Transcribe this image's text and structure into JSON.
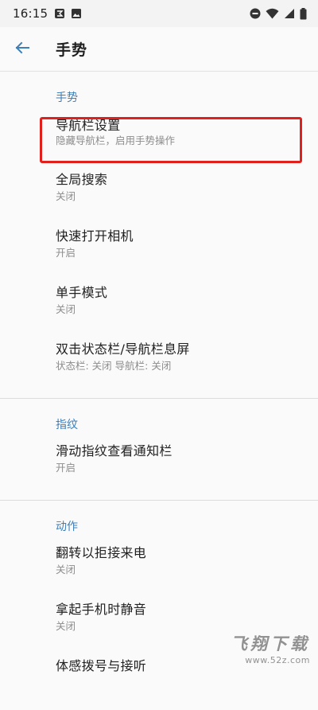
{
  "status_bar": {
    "time": "16:15",
    "left_icons": [
      "app-notification-icon",
      "image-icon"
    ],
    "right_icons": [
      "do-not-disturb-icon",
      "wifi-icon",
      "signal-icon",
      "battery-icon"
    ]
  },
  "app_bar": {
    "back_icon": "arrow-left-icon",
    "title": "手势"
  },
  "sections": [
    {
      "header": "手势",
      "items": [
        {
          "title": "导航栏设置",
          "summary": "隐藏导航栏，启用手势操作",
          "highlighted": true
        },
        {
          "title": "全局搜索",
          "summary": "关闭"
        },
        {
          "title": "快速打开相机",
          "summary": "开启"
        },
        {
          "title": "单手模式",
          "summary": "关闭"
        },
        {
          "title": "双击状态栏/导航栏息屏",
          "summary": "状态栏: 关闭  导航栏: 关闭"
        }
      ]
    },
    {
      "header": "指纹",
      "items": [
        {
          "title": "滑动指纹查看通知栏",
          "summary": "开启"
        }
      ]
    },
    {
      "header": "动作",
      "items": [
        {
          "title": "翻转以拒接来电",
          "summary": "关闭"
        },
        {
          "title": "拿起手机时静音",
          "summary": "关闭"
        },
        {
          "title": "体感拨号与接听",
          "summary": ""
        }
      ]
    }
  ],
  "colors": {
    "accent": "#3f7fb8",
    "highlight_border": "#e0201c",
    "background": "#fafafa"
  },
  "watermark": {
    "title": "飞翔下载",
    "url": "www.52z.com"
  }
}
